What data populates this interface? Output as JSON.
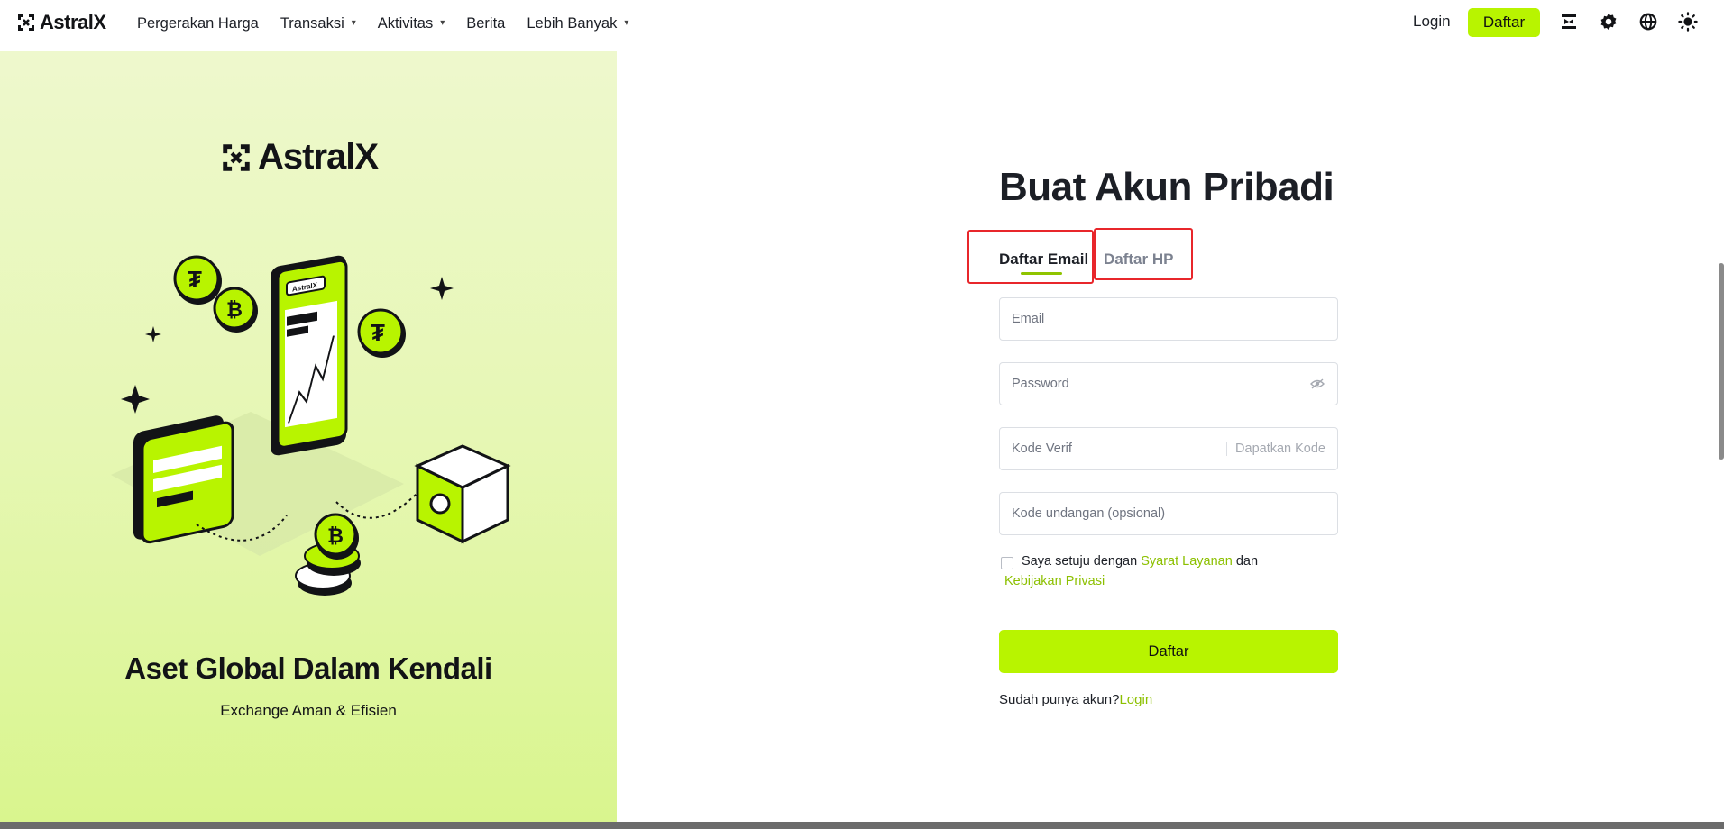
{
  "header": {
    "brand": "AstralX",
    "nav": [
      {
        "label": "Pergerakan Harga",
        "dropdown": false
      },
      {
        "label": "Transaksi",
        "dropdown": true
      },
      {
        "label": "Aktivitas",
        "dropdown": true
      },
      {
        "label": "Berita",
        "dropdown": false
      },
      {
        "label": "Lebih Banyak",
        "dropdown": true
      }
    ],
    "login_label": "Login",
    "signup_label": "Daftar",
    "icons": [
      "download-icon",
      "gear-icon",
      "globe-icon",
      "theme-toggle-icon"
    ]
  },
  "promo": {
    "logo_text": "AstralX",
    "title": "Aset Global Dalam Kendali",
    "subtitle": "Exchange Aman & Efisien",
    "illustration_phone_label": "AstralX"
  },
  "form": {
    "title": "Buat Akun Pribadi",
    "tabs": [
      {
        "label": "Daftar Email",
        "active": true
      },
      {
        "label": "Daftar HP",
        "active": false
      }
    ],
    "email_placeholder": "Email",
    "password_placeholder": "Password",
    "verif_placeholder": "Kode Verif",
    "get_code_label": "Dapatkan Kode",
    "invite_placeholder": "Kode undangan (opsional)",
    "agree_prefix": "Saya setuju dengan ",
    "terms_link": "Syarat Layanan",
    "agree_and": " dan",
    "privacy_link": "Kebijakan Privasi",
    "submit_label": "Daftar",
    "have_account_text": "Sudah punya akun?",
    "login_link": "Login"
  },
  "colors": {
    "accent": "#b8f400",
    "link": "#8cc000",
    "highlight_box": "#e8262b",
    "text": "#1c1f26",
    "muted": "#7c8290"
  }
}
